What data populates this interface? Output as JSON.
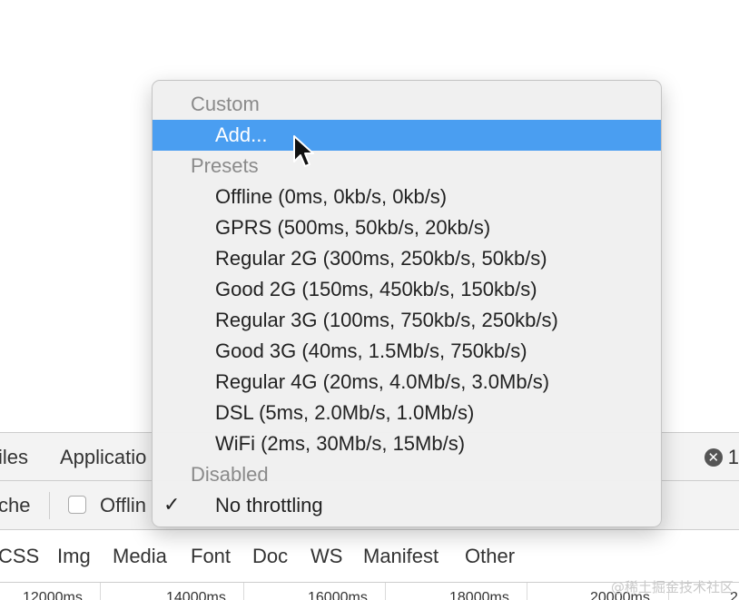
{
  "devtools_tabs": {
    "files": "iles",
    "application": "Applicatio",
    "error_count": "1"
  },
  "network_toolbar": {
    "cache_label": "che",
    "offline_label": "Offlin"
  },
  "filter_bar": {
    "items": [
      "CSS",
      "Img",
      "Media",
      "Font",
      "Doc",
      "WS",
      "Manifest",
      "Other"
    ]
  },
  "timeline": {
    "ticks": [
      "12000ms",
      "14000ms",
      "16000ms",
      "18000ms",
      "20000ms",
      "2"
    ]
  },
  "watermark": "@稀土掘金技术社区",
  "throttle_menu": {
    "custom_header": "Custom",
    "add_item": "Add...",
    "presets_header": "Presets",
    "presets": [
      "Offline (0ms, 0kb/s, 0kb/s)",
      "GPRS (500ms, 50kb/s, 20kb/s)",
      "Regular 2G (300ms, 250kb/s, 50kb/s)",
      "Good 2G (150ms, 450kb/s, 150kb/s)",
      "Regular 3G (100ms, 750kb/s, 250kb/s)",
      "Good 3G (40ms, 1.5Mb/s, 750kb/s)",
      "Regular 4G (20ms, 4.0Mb/s, 3.0Mb/s)",
      "DSL (5ms, 2.0Mb/s, 1.0Mb/s)",
      "WiFi (2ms, 30Mb/s, 15Mb/s)"
    ],
    "disabled_header": "Disabled",
    "no_throttling": "No throttling",
    "check_mark": "✓",
    "highlight_color": "#4a9ef1"
  }
}
